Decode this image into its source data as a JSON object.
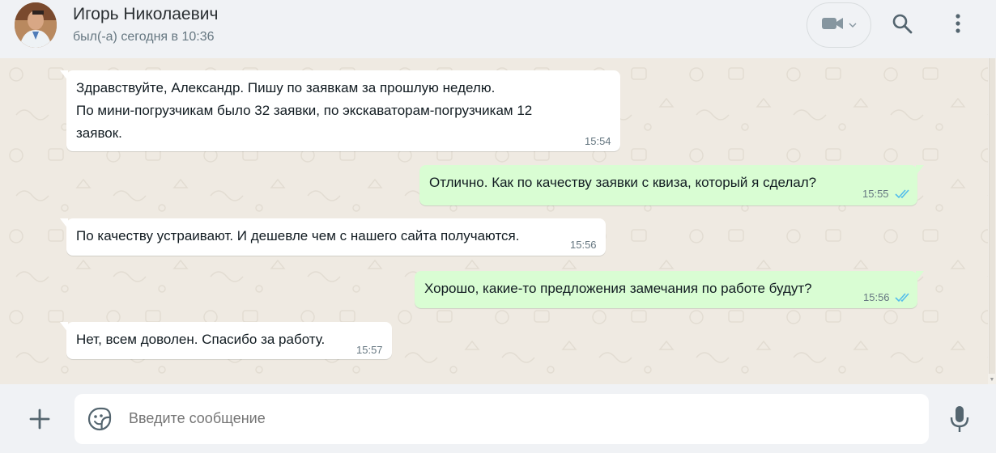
{
  "header": {
    "contact_name": "Игорь Николаевич",
    "last_seen": "был(-а) сегодня в 10:36",
    "icons": [
      "video-call-icon",
      "chevron-down-icon",
      "search-icon",
      "more-vertical-icon"
    ]
  },
  "messages": [
    {
      "direction": "in",
      "text": "Здравствуйте, Александр. Пишу по заявкам за прошлую неделю.\nПо мини-погрузчикам было 32 заявки, по экскаваторам-погрузчикам 12\nзаявок.",
      "time": "15:54"
    },
    {
      "direction": "out",
      "text": "Отлично. Как по качеству заявки с квиза, который я сделал?",
      "time": "15:55",
      "status": "read"
    },
    {
      "direction": "in",
      "text": "По качеству устраивают. И дешевле чем с нашего сайта получаются.",
      "time": "15:56"
    },
    {
      "direction": "out",
      "text": "Хорошо, какие-то предложения замечания по работе будут?",
      "time": "15:56",
      "status": "read"
    },
    {
      "direction": "in",
      "text": "Нет, всем доволен. Спасибо за работу.",
      "time": "15:57"
    }
  ],
  "composer": {
    "placeholder": "Введите сообщение",
    "icons": [
      "plus-icon",
      "sticker-icon",
      "microphone-icon"
    ]
  },
  "colors": {
    "incoming_bubble": "#ffffff",
    "outgoing_bubble": "#d9fdd3",
    "chat_background": "#efeae2",
    "read_tick": "#53bdeb"
  }
}
